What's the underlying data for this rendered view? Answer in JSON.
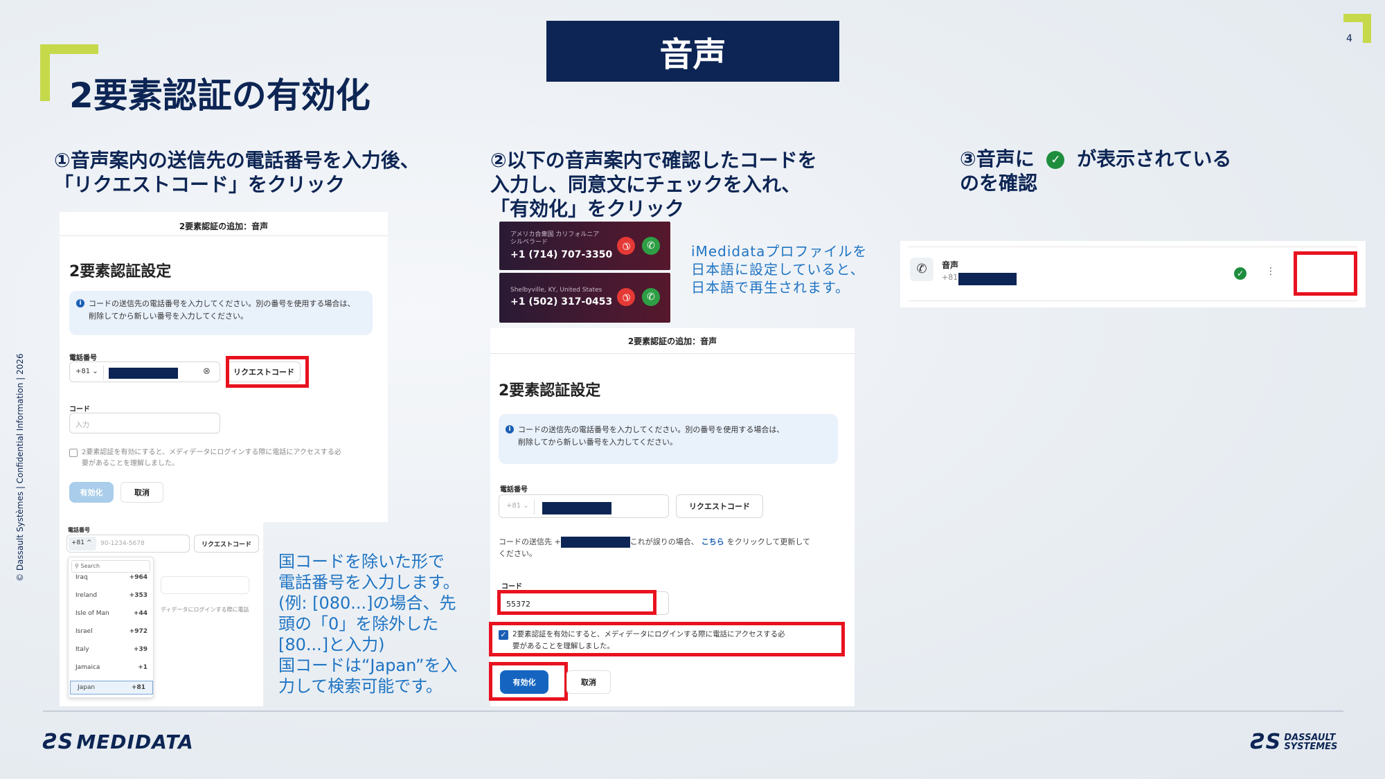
{
  "page": {
    "title": "2要素認証の有効化",
    "banner": "音声",
    "page_number": "4",
    "side_text": "© Dassault Systèmes | Confidential Information | 2026"
  },
  "steps": {
    "step1": [
      "①音声案内の送信先の電話番号を入力後、",
      "「リクエストコード」をクリック"
    ],
    "step2": [
      "②以下の音声案内で確認したコードを",
      "入力し、同意文にチェックを入れ、",
      "「有効化」をクリック"
    ],
    "step3_a": "③音声に",
    "step3_b": "が表示されている",
    "step3_c": "のを確認"
  },
  "notes": {
    "imedidata": [
      "iMedidataプロファイルを",
      "日本語に設定していると、",
      "日本語で再生されます。"
    ],
    "country_code": [
      "国コードを除いた形で",
      "電話番号を入力します。",
      "(例: [080...]の場合、先",
      "頭の「0」を除外した",
      "[80...]と入力)",
      "国コードは“Japan”を入",
      "力して検索可能です。"
    ]
  },
  "panel1": {
    "header": "2要素認証の追加：音声",
    "heading": "2要素認証設定",
    "info": [
      "コードの送信先の電話番号を入力してください。別の番号を使用する場合は、",
      "削除してから新しい番号を入力してください。"
    ],
    "phone_label": "電話番号",
    "country_code": "+81",
    "chevron": "⌄",
    "clear_icon": "⊗",
    "request_button": "リクエストコード",
    "code_label": "コード",
    "code_placeholder": "入力",
    "consent": [
      "2要素認証を有効にすると、メディデータにログインする際に電話にアクセスする必",
      "要があることを理解しました。"
    ],
    "enable_button": "有効化",
    "cancel_button": "取消"
  },
  "panel_dropdown": {
    "phone_label": "電話番号",
    "country_code": "+81",
    "chevron": "^",
    "placeholder": "90-1234-5678",
    "request_button": "リクエストコード",
    "search_placeholder": "Search",
    "behind_text": "ディデータにログインする際に電話",
    "countries": [
      {
        "name": "Iraq",
        "code": "+964"
      },
      {
        "name": "Ireland",
        "code": "+353"
      },
      {
        "name": "Isle of Man",
        "code": "+44"
      },
      {
        "name": "Israel",
        "code": "+972"
      },
      {
        "name": "Italy",
        "code": "+39"
      },
      {
        "name": "Jamaica",
        "code": "+1"
      },
      {
        "name": "Japan",
        "code": "+81"
      }
    ]
  },
  "calls": [
    {
      "location": [
        "アメリカ合衆国 カリフォルニア",
        "シルベラード"
      ],
      "number": "+1 (714) 707-3350"
    },
    {
      "location": [
        "Shelbyville, KY, United States"
      ],
      "number": "+1 (502) 317-0453"
    }
  ],
  "panel2": {
    "header": "2要素認証の追加：音声",
    "heading": "2要素認証設定",
    "info": [
      "コードの送信先の電話番号を入力してください。別の番号を使用する場合は、",
      "削除してから新しい番号を入力してください。"
    ],
    "phone_label": "電話番号",
    "country_code": "+81",
    "chevron": "⌄",
    "request_button": "リクエストコード",
    "sent_prefix": "コードの送信先 +",
    "sent_suffix": "これが誤りの場合、",
    "link": "こちら",
    "sent_tail": "をクリックして更新して",
    "sent_tail2": "ください。",
    "code_label": "コード",
    "code_value": "55372",
    "consent": [
      "2要素認証を有効にすると、メディデータにログインする際に電話にアクセスする必",
      "要があることを理解しました。"
    ],
    "enable_button": "有効化",
    "cancel_button": "取消"
  },
  "panel3": {
    "method": "音声",
    "prefix": "+81",
    "more_icon": "⋮"
  },
  "glyphs": {
    "check": "✓",
    "phone": "✆",
    "info": "i"
  },
  "footer": {
    "medidata_logo": "MEDIDATA",
    "ds_logo": [
      "DASSAULT",
      "SYSTEMES"
    ]
  },
  "colors": {
    "navy": "#0d2554",
    "lime": "#c6d94b",
    "highlight_red": "#e8121f",
    "button_blue": "#1565c0",
    "note_blue": "#1f74c3",
    "success_green": "#1e8e3e"
  }
}
